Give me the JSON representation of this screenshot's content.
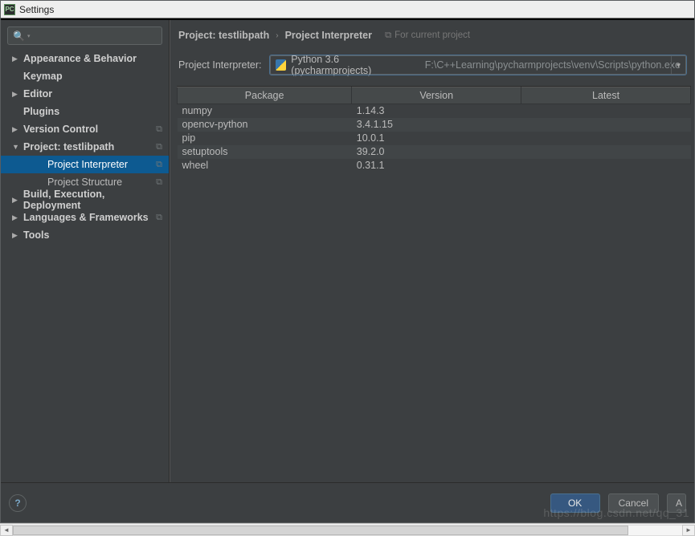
{
  "titlebar": {
    "app_icon_text": "PC",
    "title": "Settings"
  },
  "sidebar": {
    "search_placeholder": "",
    "items": [
      {
        "label": "Appearance & Behavior",
        "arrow": "right",
        "bold": true
      },
      {
        "label": "Keymap",
        "arrow": "none",
        "bold": true
      },
      {
        "label": "Editor",
        "arrow": "right",
        "bold": true
      },
      {
        "label": "Plugins",
        "arrow": "none",
        "bold": true
      },
      {
        "label": "Version Control",
        "arrow": "right",
        "bold": true,
        "icon": true
      },
      {
        "label": "Project: testlibpath",
        "arrow": "down",
        "bold": true,
        "icon": true
      },
      {
        "label": "Project Interpreter",
        "arrow": "none",
        "bold": false,
        "child": true,
        "selected": true,
        "icon": true
      },
      {
        "label": "Project Structure",
        "arrow": "none",
        "bold": false,
        "child": true,
        "icon": true
      },
      {
        "label": "Build, Execution, Deployment",
        "arrow": "right",
        "bold": true
      },
      {
        "label": "Languages & Frameworks",
        "arrow": "right",
        "bold": true,
        "icon": true
      },
      {
        "label": "Tools",
        "arrow": "right",
        "bold": true
      }
    ]
  },
  "breadcrumb": {
    "part1": "Project: testlibpath",
    "sep": "›",
    "part2": "Project Interpreter",
    "hint": "For current project"
  },
  "interpreter": {
    "label": "Project Interpreter:",
    "name": "Python 3.6 (pycharmprojects)",
    "path": "F:\\C++Learning\\pycharmprojects\\venv\\Scripts\\python.exe"
  },
  "table": {
    "headers": {
      "package": "Package",
      "version": "Version",
      "latest": "Latest"
    },
    "rows": [
      {
        "package": "numpy",
        "version": "1.14.3",
        "latest": ""
      },
      {
        "package": "opencv-python",
        "version": "3.4.1.15",
        "latest": ""
      },
      {
        "package": "pip",
        "version": "10.0.1",
        "latest": ""
      },
      {
        "package": "setuptools",
        "version": "39.2.0",
        "latest": ""
      },
      {
        "package": "wheel",
        "version": "0.31.1",
        "latest": ""
      }
    ]
  },
  "footer": {
    "help": "?",
    "ok": "OK",
    "cancel": "Cancel",
    "apply_cut": "A"
  },
  "watermark": "https://blog.csdn.net/qq_31",
  "arrows": {
    "right": "▶",
    "down": "▼"
  }
}
